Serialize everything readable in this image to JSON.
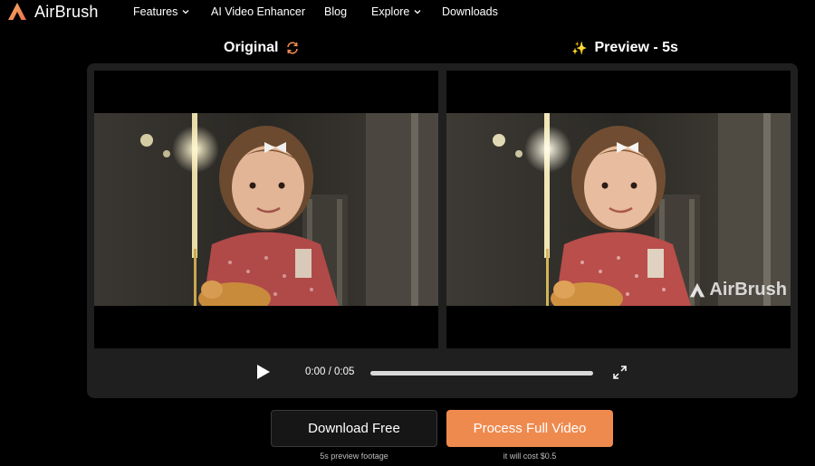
{
  "nav": {
    "brand": "AirBrush",
    "items": [
      {
        "label": "Features",
        "has_dropdown": true
      },
      {
        "label": "AI Video Enhancer",
        "has_dropdown": false
      },
      {
        "label": "Blog",
        "has_dropdown": false
      },
      {
        "label": "Explore",
        "has_dropdown": true
      },
      {
        "label": "Downloads",
        "has_dropdown": false
      }
    ]
  },
  "compare": {
    "original_title": "Original",
    "preview_title": "Preview - 5s",
    "preview_icon": "sparkle-icon",
    "original_icon": "refresh-icon",
    "watermark": "AirBrush"
  },
  "player": {
    "current_time": "0:00",
    "separator": " / ",
    "duration": "0:05",
    "progress_fraction": 0,
    "play_icon": "play-icon",
    "fullscreen_icon": "fullscreen-icon"
  },
  "actions": {
    "download_label": "Download Free",
    "download_note": "5s preview footage",
    "process_label": "Process Full Video",
    "process_note": "it will cost $0.5"
  },
  "colors": {
    "accent": "#ef8a4f",
    "background": "#000000",
    "panel": "#1f1f1f"
  }
}
